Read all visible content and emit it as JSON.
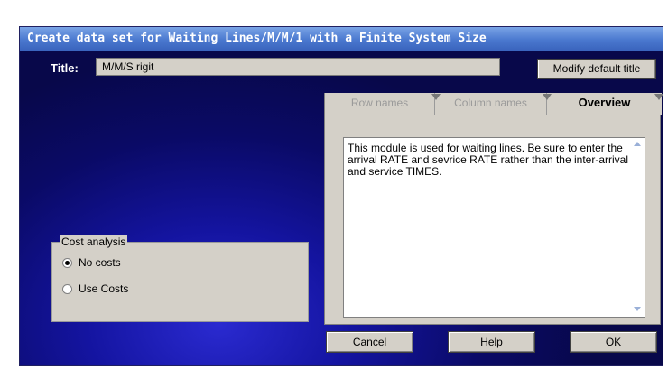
{
  "window": {
    "title": "Create data set for Waiting Lines/M/M/1 with a Finite System Size"
  },
  "title_field": {
    "label": "Title:",
    "value": "M/M/S rigit"
  },
  "buttons": {
    "modify": "Modify default title",
    "cancel": "Cancel",
    "help": "Help",
    "ok": "OK"
  },
  "tabs": [
    {
      "label": "Row names",
      "enabled": false
    },
    {
      "label": "Column names",
      "enabled": false
    },
    {
      "label": "Overview",
      "active": true
    }
  ],
  "overview_text": "This module is used for waiting lines. Be sure to enter the arrival RATE and sevrice RATE rather than the inter-arrival and service TIMES.",
  "cost_analysis": {
    "title": "Cost analysis",
    "options": [
      {
        "label": "No costs",
        "selected": true
      },
      {
        "label": "Use Costs",
        "selected": false
      }
    ]
  },
  "colors": {
    "titlebar": "#4a78cf",
    "background": "#1414a0",
    "control": "#d4d0c8"
  }
}
